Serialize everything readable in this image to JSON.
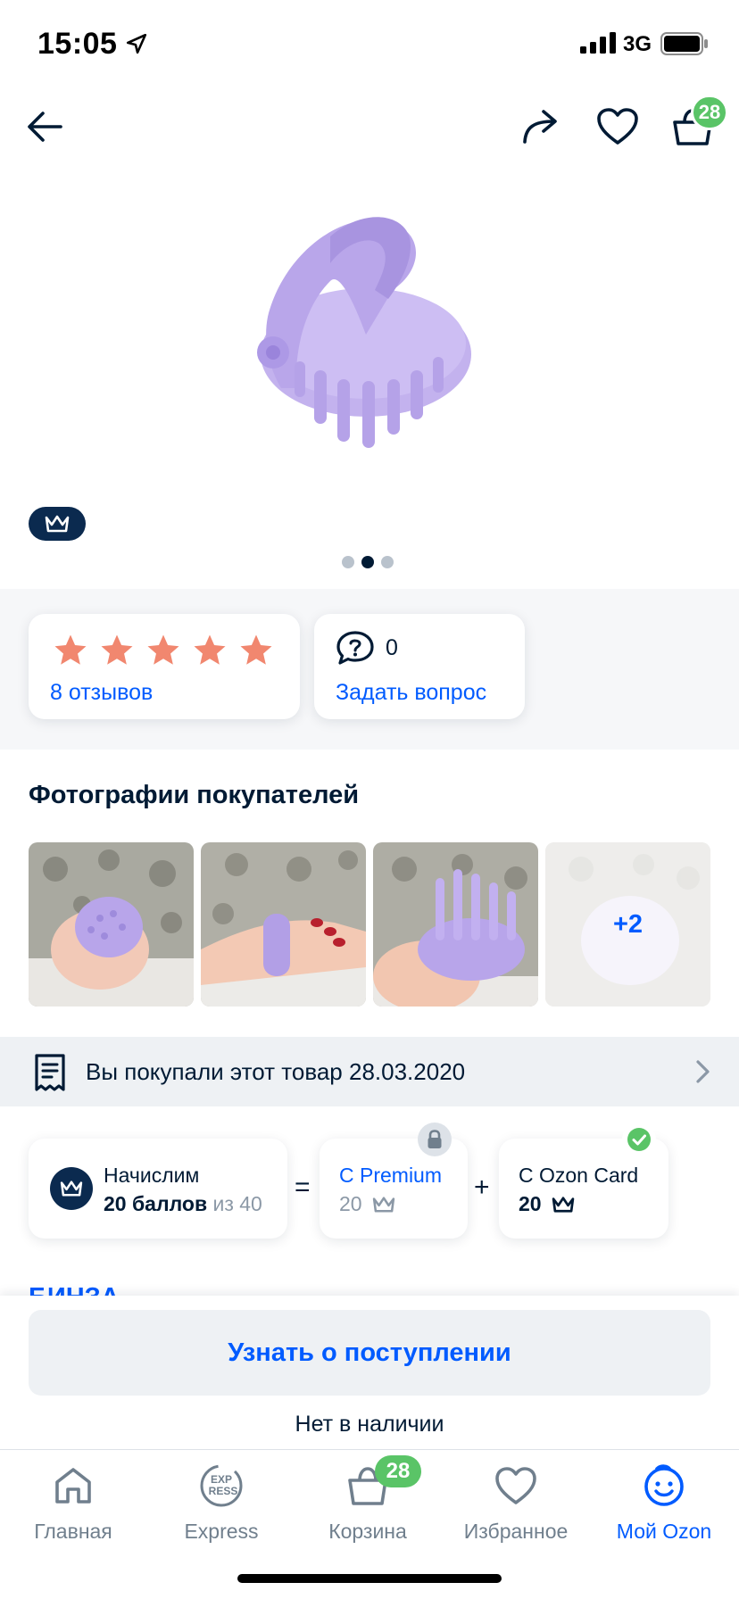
{
  "status_bar": {
    "time": "15:05",
    "network": "3G"
  },
  "header": {
    "cart_badge": "28"
  },
  "gallery": {
    "total_images": 3,
    "active_index": 1
  },
  "rating": {
    "stars": 5,
    "reviews_label": "8 отзывов"
  },
  "questions": {
    "count": "0",
    "ask_label": "Задать вопрос"
  },
  "buyer_photos": {
    "title": "Фотографии покупателей",
    "more_label": "+2"
  },
  "purchase_notice": {
    "text": "Вы покупали этот товар 28.03.2020"
  },
  "points": {
    "label": "Начислим",
    "value": "20 баллов",
    "of": "из 40",
    "equals": "=",
    "plus": "+",
    "premium": {
      "title": "С Premium",
      "value": "20"
    },
    "ozon_card": {
      "title": "С Ozon Card",
      "value": "20"
    }
  },
  "cut_off_text": "БИНЗА",
  "actions": {
    "notify_label": "Узнать о поступлении",
    "availability": "Нет в наличии"
  },
  "tabs": [
    {
      "label": "Главная",
      "icon": "home-icon"
    },
    {
      "label": "Express",
      "icon": "express-icon"
    },
    {
      "label": "Корзина",
      "icon": "cart-icon",
      "badge": "28"
    },
    {
      "label": "Избранное",
      "icon": "heart-icon"
    },
    {
      "label": "Мой Ozon",
      "icon": "profile-icon",
      "active": true
    }
  ],
  "colors": {
    "accent": "#005bff",
    "badge_green": "#5ac467",
    "star": "#f1876f",
    "dark": "#001a34",
    "product": "#c3b2ee"
  }
}
